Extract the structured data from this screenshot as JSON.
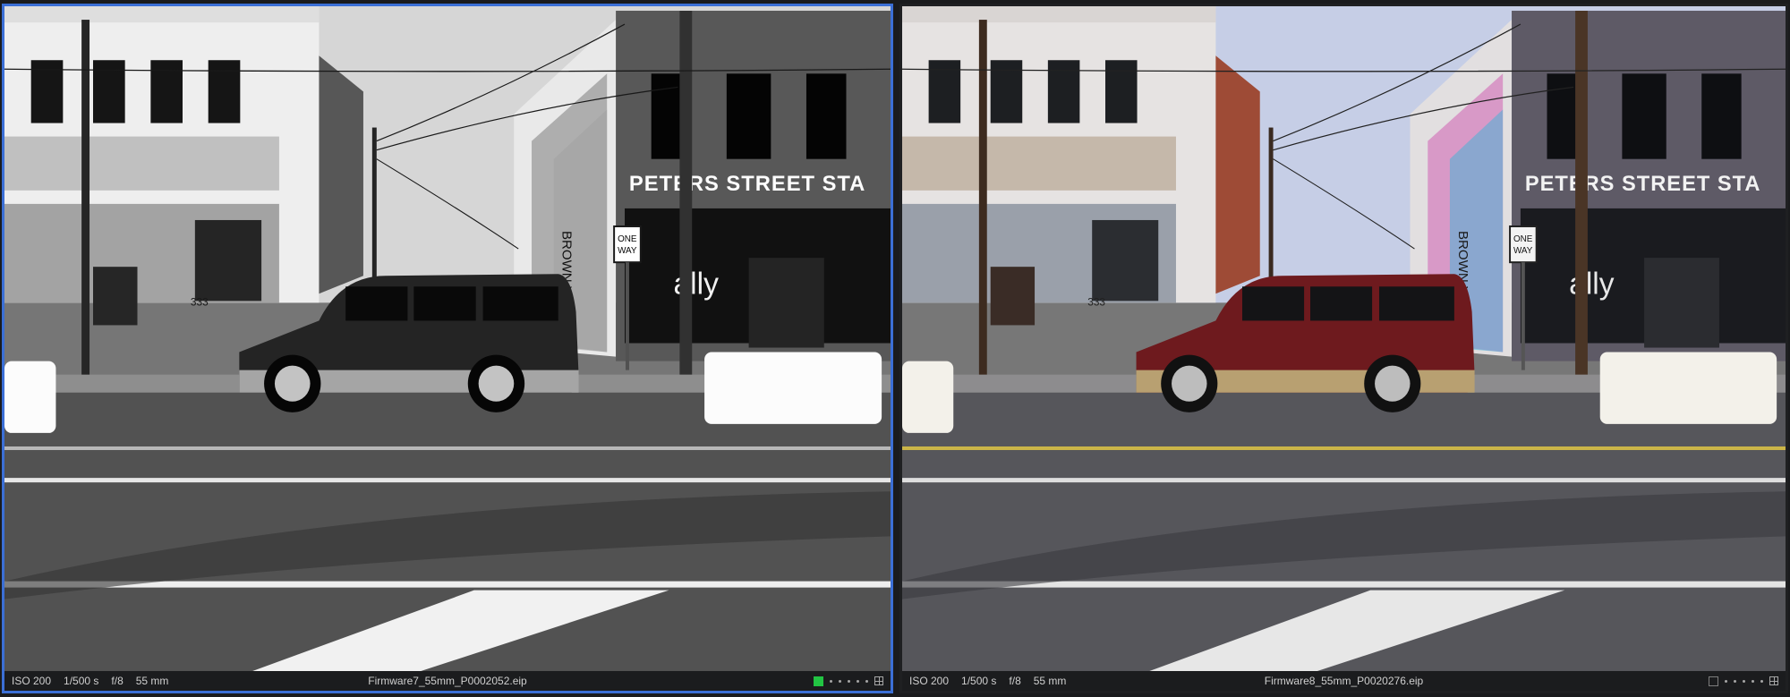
{
  "viewers": [
    {
      "id": "left",
      "mode": "monochrome",
      "selected": true,
      "status": {
        "iso": "ISO 200",
        "shutter": "1/500 s",
        "aperture": "f/8",
        "focal": "55 mm",
        "filename": "Firmware7_55mm_P0002052.eip"
      },
      "sign": {
        "building": "PETERS STREET STA",
        "oneway_top": "ONE",
        "oneway_bottom": "WAY",
        "shop": "ally",
        "mural_text": "BROWN YOU'RE BEAUTIFUL",
        "address": "333"
      },
      "rating_color": "#22c443"
    },
    {
      "id": "right",
      "mode": "color",
      "selected": false,
      "status": {
        "iso": "ISO 200",
        "shutter": "1/500 s",
        "aperture": "f/8",
        "focal": "55 mm",
        "filename": "Firmware8_55mm_P0020276.eip"
      },
      "sign": {
        "building": "PETERS STREET STA",
        "oneway_top": "ONE",
        "oneway_bottom": "WAY",
        "shop": "ally",
        "mural_text": "BROWN YOU'RE BEAUTIFUL",
        "address": "333"
      },
      "rating_color": ""
    }
  ],
  "colors": {
    "selection_border": "#3b6fd6",
    "sky": "#c6cee6",
    "suv_red": "#6e1a1e",
    "suv_gold": "#b8a071"
  }
}
